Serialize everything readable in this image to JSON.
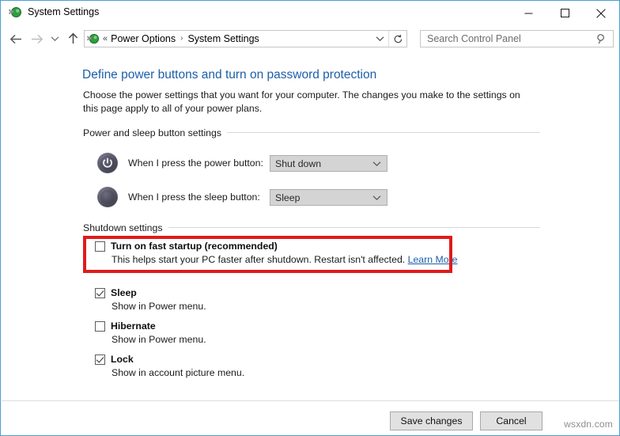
{
  "window": {
    "title": "System Settings",
    "app_icon": "power-plug-icon",
    "caption": {
      "minimize": "minimize-icon",
      "maximize": "maximize-icon",
      "close": "close-icon"
    }
  },
  "nav": {
    "back": "back-arrow-icon",
    "forward": "forward-arrow-icon",
    "recent": "chevron-down-icon",
    "up": "up-arrow-icon",
    "address": {
      "icon": "power-plug-icon",
      "overflow": "«",
      "crumbs": [
        "Power Options",
        "System Settings"
      ],
      "separator": "›",
      "dropdown": "chevron-down-icon",
      "refresh": "refresh-icon"
    },
    "search": {
      "placeholder": "Search Control Panel",
      "icon": "search-icon"
    }
  },
  "page": {
    "title": "Define power buttons and turn on password protection",
    "description": "Choose the power settings that you want for your computer. The changes you make to the settings on this page apply to all of your power plans."
  },
  "power_sleep_group": {
    "header": "Power and sleep button settings",
    "rows": [
      {
        "icon": "power-button-icon",
        "label": "When I press the power button:",
        "value": "Shut down",
        "arrow": "chevron-down-icon"
      },
      {
        "icon": "sleep-moon-icon",
        "label": "When I press the sleep button:",
        "value": "Sleep",
        "arrow": "chevron-down-icon"
      }
    ]
  },
  "shutdown_group": {
    "header": "Shutdown settings",
    "items": [
      {
        "title": "Turn on fast startup (recommended)",
        "checked": false,
        "description": "This helps start your PC faster after shutdown. Restart isn't affected.",
        "link": "Learn More",
        "highlighted": true
      },
      {
        "title": "Sleep",
        "checked": true,
        "description": "Show in Power menu.",
        "link": "",
        "highlighted": false
      },
      {
        "title": "Hibernate",
        "checked": false,
        "description": "Show in Power menu.",
        "link": "",
        "highlighted": false
      },
      {
        "title": "Lock",
        "checked": true,
        "description": "Show in account picture menu.",
        "link": "",
        "highlighted": false
      }
    ]
  },
  "footer": {
    "save_label": "Save changes",
    "cancel_label": "Cancel"
  },
  "watermark": "wsxdn.com",
  "colors": {
    "window_border": "#4a9fd8",
    "title_link": "#1c5fa8",
    "highlight": "#e01b1b",
    "combo_fill": "#d4d4d4"
  }
}
